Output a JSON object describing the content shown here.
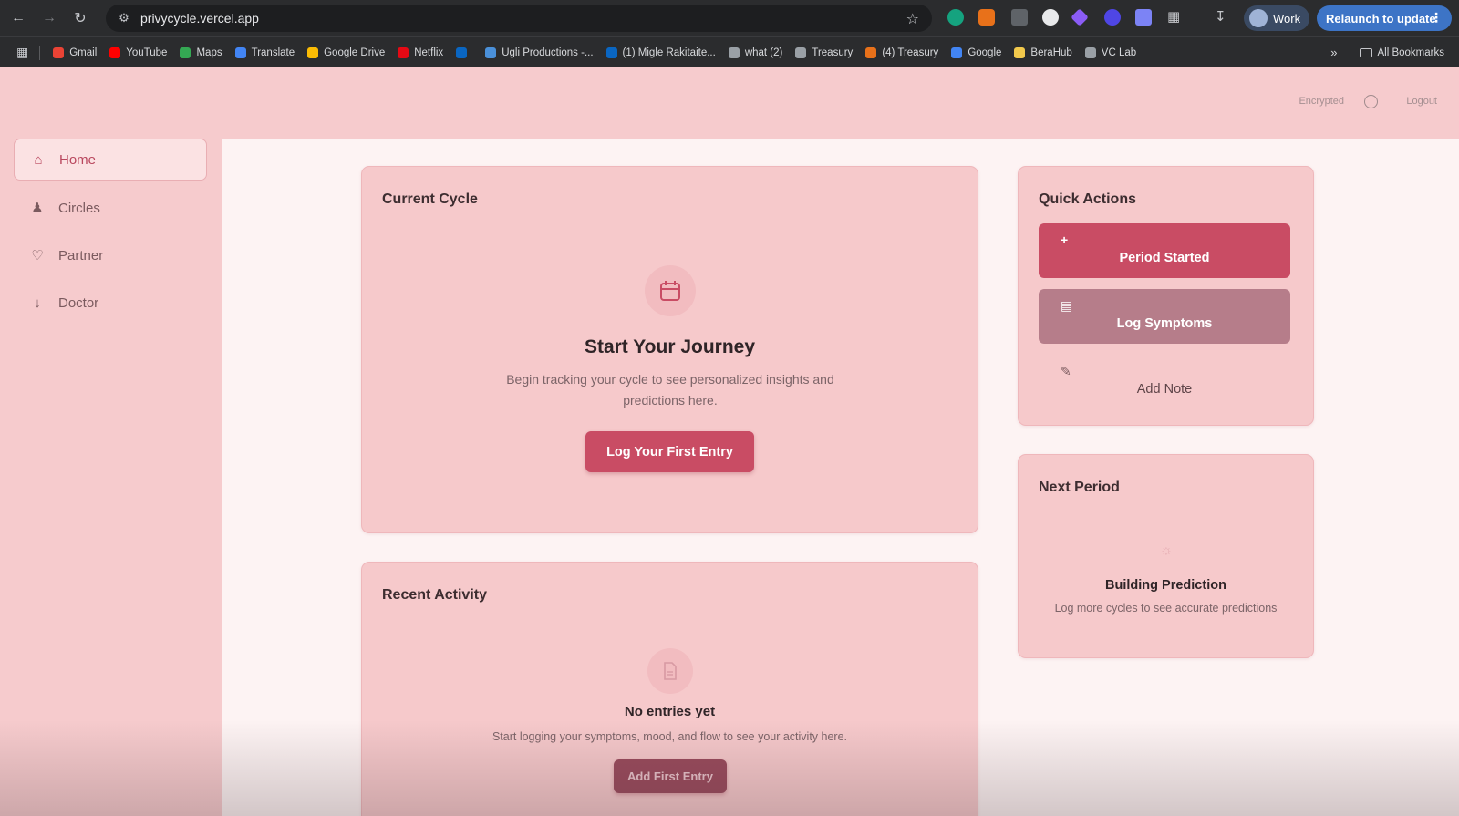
{
  "browser": {
    "url": "privycycle.vercel.app",
    "profile_label": "Work",
    "relaunch_label": "Relaunch to update",
    "bookmarks": [
      {
        "label": "Gmail",
        "color": "#ea4335"
      },
      {
        "label": "YouTube",
        "color": "#ff0000"
      },
      {
        "label": "Maps",
        "color": "#34a853"
      },
      {
        "label": "Translate",
        "color": "#4285f4"
      },
      {
        "label": "Google Drive",
        "color": "#fbbc04"
      },
      {
        "label": "Netflix",
        "color": "#e50914"
      },
      {
        "label": "",
        "color": "#0a66c2"
      },
      {
        "label": "Ugli Productions -...",
        "color": "#4a90d9"
      },
      {
        "label": "(1) Migle Rakitaite...",
        "color": "#0a66c2"
      },
      {
        "label": "what (2)",
        "color": "#9aa0a6"
      },
      {
        "label": "Treasury",
        "color": "#9aa0a6"
      },
      {
        "label": "(4) Treasury",
        "color": "#e8711a"
      },
      {
        "label": "Google",
        "color": "#4285f4"
      },
      {
        "label": "BeraHub",
        "color": "#f2c94c"
      },
      {
        "label": "VC Lab",
        "color": "#9aa0a6"
      }
    ],
    "all_bookmarks_label": "All Bookmarks"
  },
  "header": {
    "encrypted_label": "Encrypted",
    "logout_label": "Logout"
  },
  "sidebar": {
    "items": [
      {
        "label": "Home",
        "icon": "home-icon"
      },
      {
        "label": "Circles",
        "icon": "people-icon"
      },
      {
        "label": "Partner",
        "icon": "heart-icon"
      },
      {
        "label": "Doctor",
        "icon": "arrow-down-icon"
      }
    ]
  },
  "current_cycle": {
    "title": "Current Cycle",
    "heading": "Start Your Journey",
    "subtitle": "Begin tracking your cycle to see personalized insights and predictions here.",
    "button": "Log Your First Entry"
  },
  "recent_activity": {
    "title": "Recent Activity",
    "heading": "No entries yet",
    "subtitle": "Start logging your symptoms, mood, and flow to see your activity here.",
    "button": "Add First Entry"
  },
  "quick_actions": {
    "title": "Quick Actions",
    "actions": [
      {
        "label": "Period Started",
        "icon": "plus-icon",
        "color": "#c94c64"
      },
      {
        "label": "Log Symptoms",
        "icon": "document-icon",
        "color": "#b67d8a"
      },
      {
        "label": "Add Note",
        "icon": "edit-icon",
        "color": "transparent"
      }
    ]
  },
  "next_period": {
    "title": "Next Period",
    "heading": "Building Prediction",
    "subtitle": "Log more cycles to see accurate predictions"
  },
  "colors": {
    "accent": "#c94c64",
    "secondary": "#b67d8a",
    "background": "#f6cbcd"
  }
}
